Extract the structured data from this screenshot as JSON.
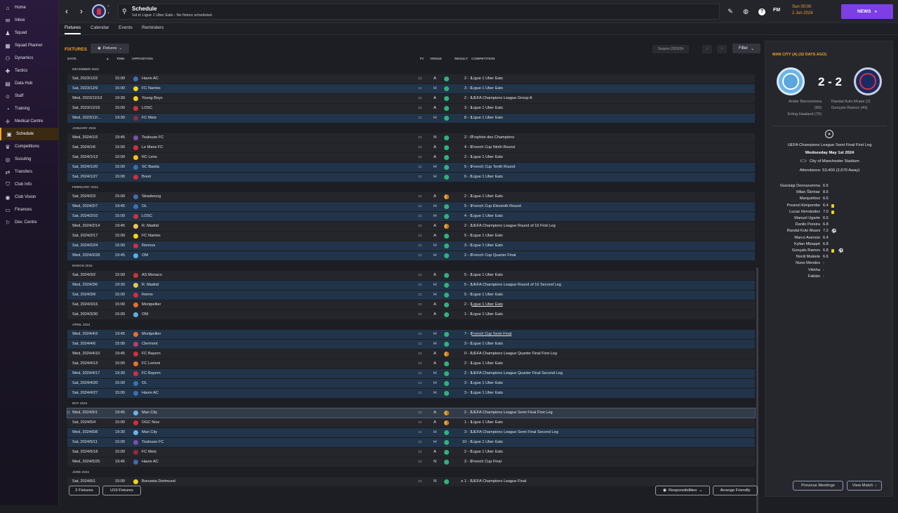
{
  "sidebar": {
    "items": [
      {
        "label": "Home",
        "icon": "home-icon",
        "glyph": "⌂"
      },
      {
        "label": "Inbox",
        "icon": "inbox-icon",
        "glyph": "✉"
      },
      {
        "label": "Squad",
        "icon": "squad-icon",
        "glyph": "♟"
      },
      {
        "label": "Squad Planner",
        "icon": "squad-planner-icon",
        "glyph": "▦"
      },
      {
        "label": "Dynamics",
        "icon": "dynamics-icon",
        "glyph": "⚇"
      },
      {
        "label": "Tactics",
        "icon": "tactics-icon",
        "glyph": "✚"
      },
      {
        "label": "Data Hub",
        "icon": "data-hub-icon",
        "glyph": "▤"
      },
      {
        "label": "Staff",
        "icon": "staff-icon",
        "glyph": "☺"
      },
      {
        "label": "Training",
        "icon": "training-icon",
        "glyph": "◔"
      },
      {
        "label": "Medical Centre",
        "icon": "medical-centre-icon",
        "glyph": "✛"
      },
      {
        "label": "Schedule",
        "icon": "schedule-icon",
        "glyph": "▣",
        "active": true
      },
      {
        "label": "Competitions",
        "icon": "competitions-icon",
        "glyph": "♛"
      },
      {
        "label": "Scouting",
        "icon": "scouting-icon",
        "glyph": "◎"
      },
      {
        "label": "Transfers",
        "icon": "transfers-icon",
        "glyph": "⇄"
      },
      {
        "label": "Club Info",
        "icon": "club-info-icon",
        "glyph": "⛉"
      },
      {
        "label": "Club Vision",
        "icon": "club-vision-icon",
        "glyph": "◉"
      },
      {
        "label": "Finances",
        "icon": "finances-icon",
        "glyph": "▭"
      },
      {
        "label": "Dev. Centre",
        "icon": "dev-centre-icon",
        "glyph": "⚐"
      }
    ]
  },
  "header": {
    "title": "Schedule",
    "subtitle": "1st in Ligue 1 Uber Eats - No fixture scheduled.",
    "fm_label": "FM",
    "time": "Sun 00:00",
    "date": "2 Jun 2024",
    "news_label": "NEWS"
  },
  "tabs": [
    "Fixtures",
    "Calendar",
    "Events",
    "Reminders"
  ],
  "toolbar": {
    "heading": "FIXTURES",
    "view_dropdown": "Fixtures",
    "season": "Season 2023/24",
    "filter": "Filter"
  },
  "columns": {
    "date": "DATE",
    "time": "TIME",
    "opposition": "OPPOSITION",
    "tv": "TV",
    "venue": "VENUE",
    "result": "RESULT",
    "competition": "COMPETITION"
  },
  "months": [
    {
      "label": "DECEMBER 2023",
      "fixtures": [
        {
          "date": "Sat, 2023/12/2",
          "time": "15:00",
          "opp": "Havre AC",
          "crest": "#3b6fb5",
          "venue": "A",
          "outcome": "win",
          "result": "2 - 1",
          "comp": "Ligue 1 Uber Eats"
        },
        {
          "date": "Sat, 2023/12/9",
          "time": "15:00",
          "opp": "FC Nantes",
          "crest": "#f2d21b",
          "venue": "H",
          "outcome": "win",
          "result": "3 - 0",
          "comp": "Ligue 1 Uber Eats"
        },
        {
          "date": "Wed, 2023/12/13",
          "time": "19:30",
          "opp": "Young Boys",
          "crest": "#f2d21b",
          "venue": "A",
          "outcome": "win",
          "result": "2 - 1",
          "comp": "UEFA Champions League Group A"
        },
        {
          "date": "Sat, 2023/12/16",
          "time": "15:00",
          "opp": "LOSC",
          "crest": "#d32f3b",
          "venue": "A",
          "outcome": "win",
          "result": "3 - 1",
          "comp": "Ligue 1 Uber Eats"
        },
        {
          "date": "Wed, 2023/12/...",
          "time": "19:30",
          "opp": "FC Metz",
          "crest": "#8e2c3c",
          "venue": "H",
          "outcome": "win",
          "result": "8 - 1",
          "comp": "Ligue 1 Uber Eats"
        }
      ]
    },
    {
      "label": "JANUARY 2024",
      "fixtures": [
        {
          "date": "Wed, 2024/1/3",
          "time": "19:45",
          "opp": "Toulouse FC",
          "crest": "#7a4fb3",
          "venue": "N",
          "outcome": "win",
          "result": "2 - 0",
          "comp": "Trophée des Champions"
        },
        {
          "date": "Sat, 2024/1/6",
          "time": "15:00",
          "opp": "Le Mans FC",
          "crest": "#d32f3b",
          "venue": "A",
          "outcome": "win",
          "result": "4 - 0",
          "comp": "French Cup Ninth Round"
        },
        {
          "date": "Sat, 2024/1/13",
          "time": "15:00",
          "opp": "RC Lens",
          "crest": "#f2c21b",
          "venue": "A",
          "outcome": "win",
          "result": "2 - 1",
          "comp": "Ligue 1 Uber Eats"
        },
        {
          "date": "Sat, 2024/1/20",
          "time": "15:00",
          "opp": "SC Bastia",
          "crest": "#3b6fb5",
          "venue": "H",
          "outcome": "win",
          "result": "5 - 1",
          "comp": "French Cup Tenth Round"
        },
        {
          "date": "Sat, 2024/1/27",
          "time": "15:00",
          "opp": "Brest",
          "crest": "#d32f3b",
          "venue": "H",
          "outcome": "win",
          "result": "6 - 0",
          "comp": "Ligue 1 Uber Eats"
        }
      ]
    },
    {
      "label": "FEBRUARY 2024",
      "fixtures": [
        {
          "date": "Sat, 2024/2/3",
          "time": "15:00",
          "opp": "Strasbourg",
          "crest": "#3b6fb5",
          "venue": "A",
          "outcome": "draw",
          "result": "2 - 2",
          "comp": "Ligue 1 Uber Eats"
        },
        {
          "date": "Wed, 2024/2/7",
          "time": "19:45",
          "opp": "OL",
          "crest": "#3b6fb5",
          "venue": "H",
          "outcome": "win",
          "result": "5 - 1",
          "comp": "French Cup Eleventh Round"
        },
        {
          "date": "Sat, 2024/2/10",
          "time": "15:00",
          "opp": "LOSC",
          "crest": "#d32f3b",
          "venue": "H",
          "outcome": "win",
          "result": "4 - 0",
          "comp": "Ligue 1 Uber Eats"
        },
        {
          "date": "Wed, 2024/2/14",
          "time": "19:45",
          "opp": "R. Madrid",
          "crest": "#e5c65a",
          "venue": "A",
          "outcome": "draw",
          "result": "2 - 2",
          "comp": "UEFA Champions League Round of 16 First Leg"
        },
        {
          "date": "Sat, 2024/2/17",
          "time": "15:00",
          "opp": "FC Nantes",
          "crest": "#f2d21b",
          "venue": "A",
          "outcome": "win",
          "result": "5 - 0",
          "comp": "Ligue 1 Uber Eats"
        },
        {
          "date": "Sat, 2024/2/24",
          "time": "15:00",
          "opp": "Rennes",
          "crest": "#d32f3b",
          "venue": "H",
          "outcome": "win",
          "result": "3 - 0",
          "comp": "Ligue 1 Uber Eats"
        },
        {
          "date": "Wed, 2024/2/28",
          "time": "19:45",
          "opp": "OM",
          "crest": "#58b2e3",
          "venue": "H",
          "outcome": "win",
          "result": "2 - 0",
          "comp": "French Cup Quarter Final"
        }
      ]
    },
    {
      "label": "MARCH 2024",
      "fixtures": [
        {
          "date": "Sat, 2024/3/2",
          "time": "15:00",
          "opp": "AS Monaco",
          "crest": "#d32f3b",
          "venue": "A",
          "outcome": "win",
          "result": "5 - 2",
          "comp": "Ligue 1 Uber Eats"
        },
        {
          "date": "Wed, 2024/3/6",
          "time": "19:30",
          "opp": "R. Madrid",
          "crest": "#e5c65a",
          "venue": "H",
          "outcome": "win",
          "result": "5 - 2",
          "comp": "UEFA Champions League Round of 16 Second Leg"
        },
        {
          "date": "Sat, 2024/3/9",
          "time": "15:00",
          "opp": "Reims",
          "crest": "#d32f3b",
          "venue": "H",
          "outcome": "win",
          "result": "5 - 0",
          "comp": "Ligue 1 Uber Eats"
        },
        {
          "date": "Sat, 2024/3/16",
          "time": "15:00",
          "opp": "Montpellier",
          "crest": "#e8702a",
          "venue": "A",
          "outcome": "win",
          "result": "2 - 1",
          "comp": "Ligue 1 Uber Eats",
          "underline": true
        },
        {
          "date": "Sat, 2024/3/30",
          "time": "15:00",
          "opp": "OM",
          "crest": "#58b2e3",
          "venue": "A",
          "outcome": "win",
          "result": "1 - 0",
          "comp": "Ligue 1 Uber Eats"
        }
      ]
    },
    {
      "label": "APRIL 2024",
      "fixtures": [
        {
          "date": "Wed, 2024/4/3",
          "time": "19:45",
          "opp": "Montpellier",
          "crest": "#e8702a",
          "venue": "H",
          "outcome": "win",
          "result": "7 - 1",
          "comp": "French Cup Semi Final",
          "underline": true
        },
        {
          "date": "Sat, 2024/4/6",
          "time": "15:00",
          "opp": "Clermont",
          "crest": "#c23b6a",
          "venue": "H",
          "outcome": "win",
          "result": "3 - 0",
          "comp": "Ligue 1 Uber Eats"
        },
        {
          "date": "Wed, 2024/4/10",
          "time": "19:45",
          "opp": "FC Bayern",
          "crest": "#d32f3b",
          "venue": "A",
          "outcome": "draw",
          "result": "0 - 0",
          "comp": "UEFA Champions League Quarter Final First Leg"
        },
        {
          "date": "Sat, 2024/4/13",
          "time": "15:00",
          "opp": "FC Lorient",
          "crest": "#e8702a",
          "venue": "A",
          "outcome": "win",
          "result": "2 - 1",
          "comp": "Ligue 1 Uber Eats"
        },
        {
          "date": "Wed, 2024/4/17",
          "time": "19:30",
          "opp": "FC Bayern",
          "crest": "#d32f3b",
          "venue": "H",
          "outcome": "win",
          "result": "2 - 1",
          "comp": "UEFA Champions League Quarter Final Second Leg"
        },
        {
          "date": "Sat, 2024/4/20",
          "time": "15:00",
          "opp": "OL",
          "crest": "#3b6fb5",
          "venue": "H",
          "outcome": "win",
          "result": "3 - 1",
          "comp": "Ligue 1 Uber Eats"
        },
        {
          "date": "Sat, 2024/4/27",
          "time": "15:00",
          "opp": "Havre AC",
          "crest": "#3b6fb5",
          "venue": "H",
          "outcome": "win",
          "result": "3 - 1",
          "comp": "Ligue 1 Uber Eats"
        }
      ]
    },
    {
      "label": "MAY 2024",
      "fixtures": [
        {
          "date": "Wed, 2024/5/1",
          "time": "19:45",
          "opp": "Man City",
          "crest": "#6cb4e8",
          "venue": "A",
          "outcome": "draw",
          "result": "2 - 2",
          "comp": "UEFA Champions League Semi Final First Leg",
          "selected": true
        },
        {
          "date": "Sat, 2024/5/4",
          "time": "15:00",
          "opp": "OGC Nice",
          "crest": "#d32f3b",
          "venue": "A",
          "outcome": "draw",
          "result": "1 - 1",
          "comp": "Ligue 1 Uber Eats"
        },
        {
          "date": "Wed, 2024/5/8",
          "time": "19:30",
          "opp": "Man City",
          "crest": "#6cb4e8",
          "venue": "H",
          "outcome": "win",
          "result": "3 - 1",
          "comp": "UEFA Champions League Semi Final Second Leg"
        },
        {
          "date": "Sat, 2024/5/11",
          "time": "15:00",
          "opp": "Toulouse FC",
          "crest": "#7a4fb3",
          "venue": "H",
          "outcome": "win",
          "result": "10 - 0",
          "comp": "Ligue 1 Uber Eats"
        },
        {
          "date": "Sat, 2024/5/18",
          "time": "15:00",
          "opp": "FC Metz",
          "crest": "#8e2c3c",
          "venue": "A",
          "outcome": "win",
          "result": "2 - 0",
          "comp": "Ligue 1 Uber Eats"
        },
        {
          "date": "Wed, 2024/5/25",
          "time": "19:45",
          "opp": "Havre AC",
          "crest": "#3b6fb5",
          "venue": "N",
          "outcome": "win",
          "result": "3 - 0",
          "comp": "French Cup Final"
        }
      ]
    },
    {
      "label": "JUNE 2024",
      "fixtures": [
        {
          "date": "Sat, 2024/6/1",
          "time": "15:00",
          "opp": "Borussia Dortmund",
          "crest": "#f2d21b",
          "venue": "N",
          "outcome": "win",
          "result": "e 1 - 0",
          "comp": "UEFA Champions League Final"
        }
      ]
    }
  ],
  "colors": {
    "win": "#2fb37a",
    "draw": "#e8a43a",
    "accent": "#f2a12b",
    "home_row": "#213449"
  },
  "footer": {
    "btn_fixtures": "2 Fixtures",
    "btn_u19": "U19 Fixtures",
    "btn_responsibilities": "Responsibilities",
    "btn_arrange": "Arrange Friendly"
  },
  "match_panel": {
    "title": "MAN CITY (A) (32 DAYS AGO)",
    "score": "2 - 2",
    "home_scorers": [
      "Ander Barrenetxea",
      "(60)",
      "Erling Haaland (70)"
    ],
    "away_scorers": [
      "Randal Kolo Muani (2)",
      "Gonçalo Ramos (40)"
    ],
    "competition": "UEFA Champions League Semi Final First Leg",
    "date": "Wednesday May 1st 2024",
    "stadium": "City of Manchester Stadium",
    "attendance": "Attendance: 53,400 (2,670 Away)",
    "ratings": [
      {
        "name": "Gianluigi Donnarumma",
        "rating": "6.6"
      },
      {
        "name": "Milan Škriniar",
        "rating": "8.5"
      },
      {
        "name": "Marquinhos",
        "rating": "6.6"
      },
      {
        "name": "Presnel Kimpembe",
        "rating": "6.4",
        "card": true
      },
      {
        "name": "Lucas Hernández",
        "rating": "7.0",
        "card": true
      },
      {
        "name": "Manuel Ugarte",
        "rating": "6.5"
      },
      {
        "name": "Danilo Pereira",
        "rating": "6.8"
      },
      {
        "name": "Randal Kolo Muani",
        "rating": "7.2",
        "goal": true
      },
      {
        "name": "Marco Asensio",
        "rating": "6.4"
      },
      {
        "name": "Kylian Mbappé",
        "rating": "6.8"
      },
      {
        "name": "Gonçalo Ramos",
        "rating": "6.8",
        "card": true,
        "goal": true
      },
      {
        "name": "Nordi Mukiele",
        "rating": "6.6"
      },
      {
        "name": "Nuno Mendes",
        "rating": "-"
      },
      {
        "name": "Vitinha",
        "rating": "-"
      },
      {
        "name": "Fabián",
        "rating": "-"
      }
    ],
    "btn_previous": "Previous Meetings",
    "btn_view": "View Match"
  }
}
